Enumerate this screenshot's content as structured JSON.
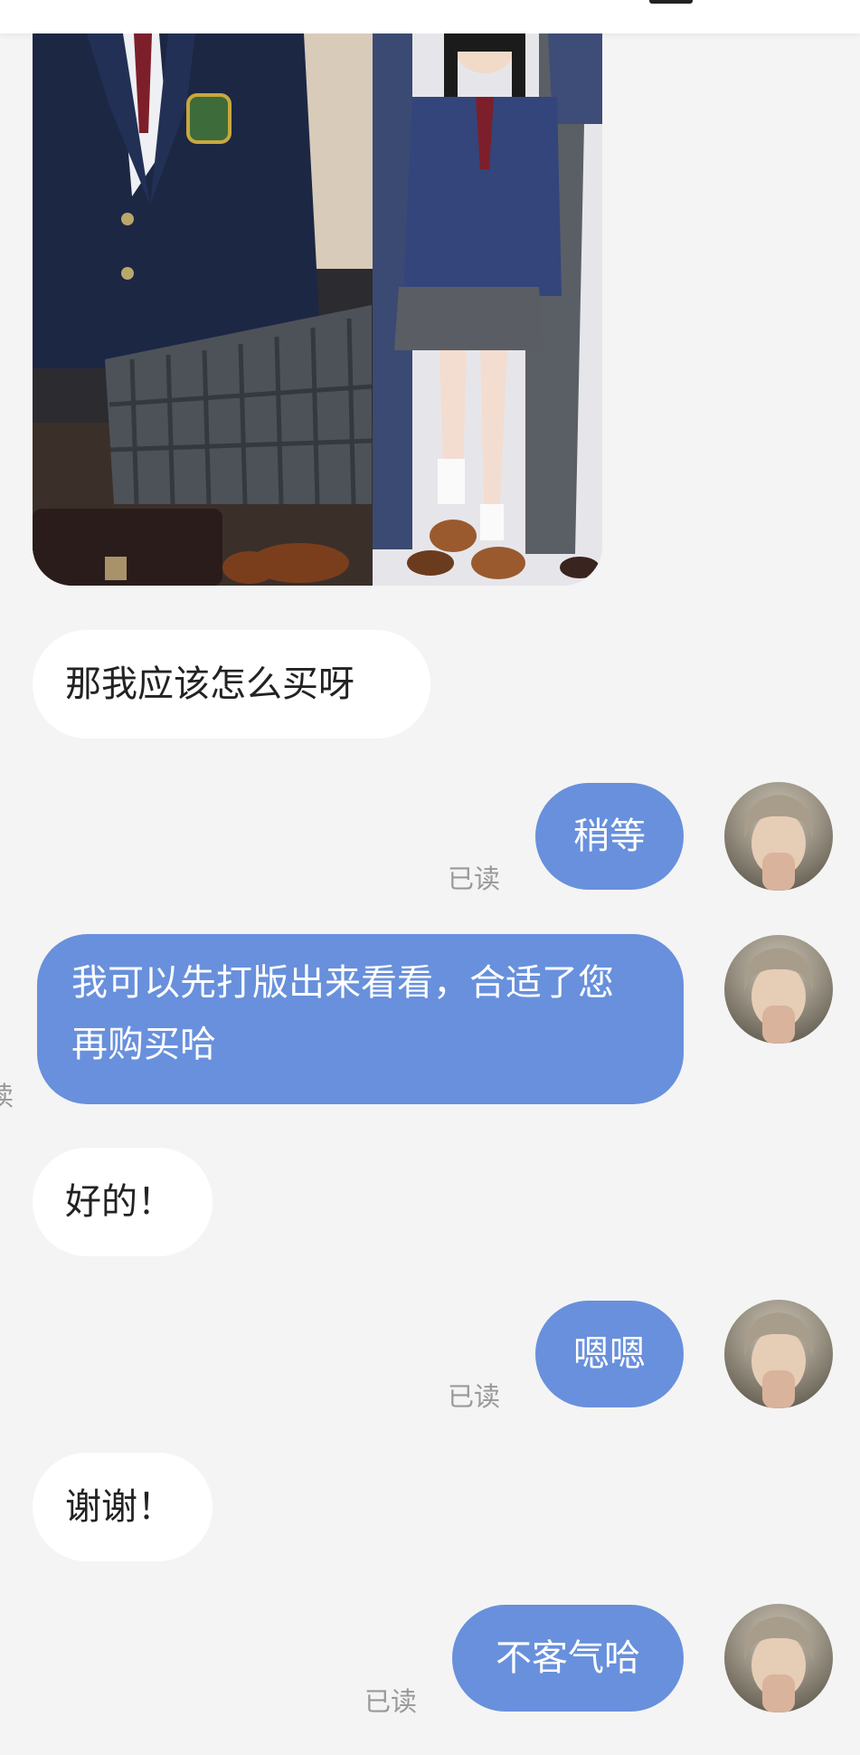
{
  "chat": {
    "messages": [
      {
        "from": "other",
        "type": "image",
        "alt": "school uniform photo"
      },
      {
        "from": "other",
        "text": "那我应该怎么买呀"
      },
      {
        "from": "me",
        "text": "稍等",
        "status": "已读"
      },
      {
        "from": "me",
        "text": "我可以先打版出来看看，合适了您再购买哈"
      },
      {
        "from": "other",
        "text": "好的！"
      },
      {
        "from": "me",
        "text": "嗯嗯",
        "status": "已读"
      },
      {
        "from": "other",
        "text": "谢谢！"
      },
      {
        "from": "me",
        "text": "不客气哈",
        "status": "已读"
      }
    ],
    "partial_left_glyph": "读"
  },
  "colors": {
    "background": "#f4f4f4",
    "incoming_bubble": "#ffffff",
    "outgoing_bubble": "#6890dc",
    "read_text": "#999999"
  }
}
